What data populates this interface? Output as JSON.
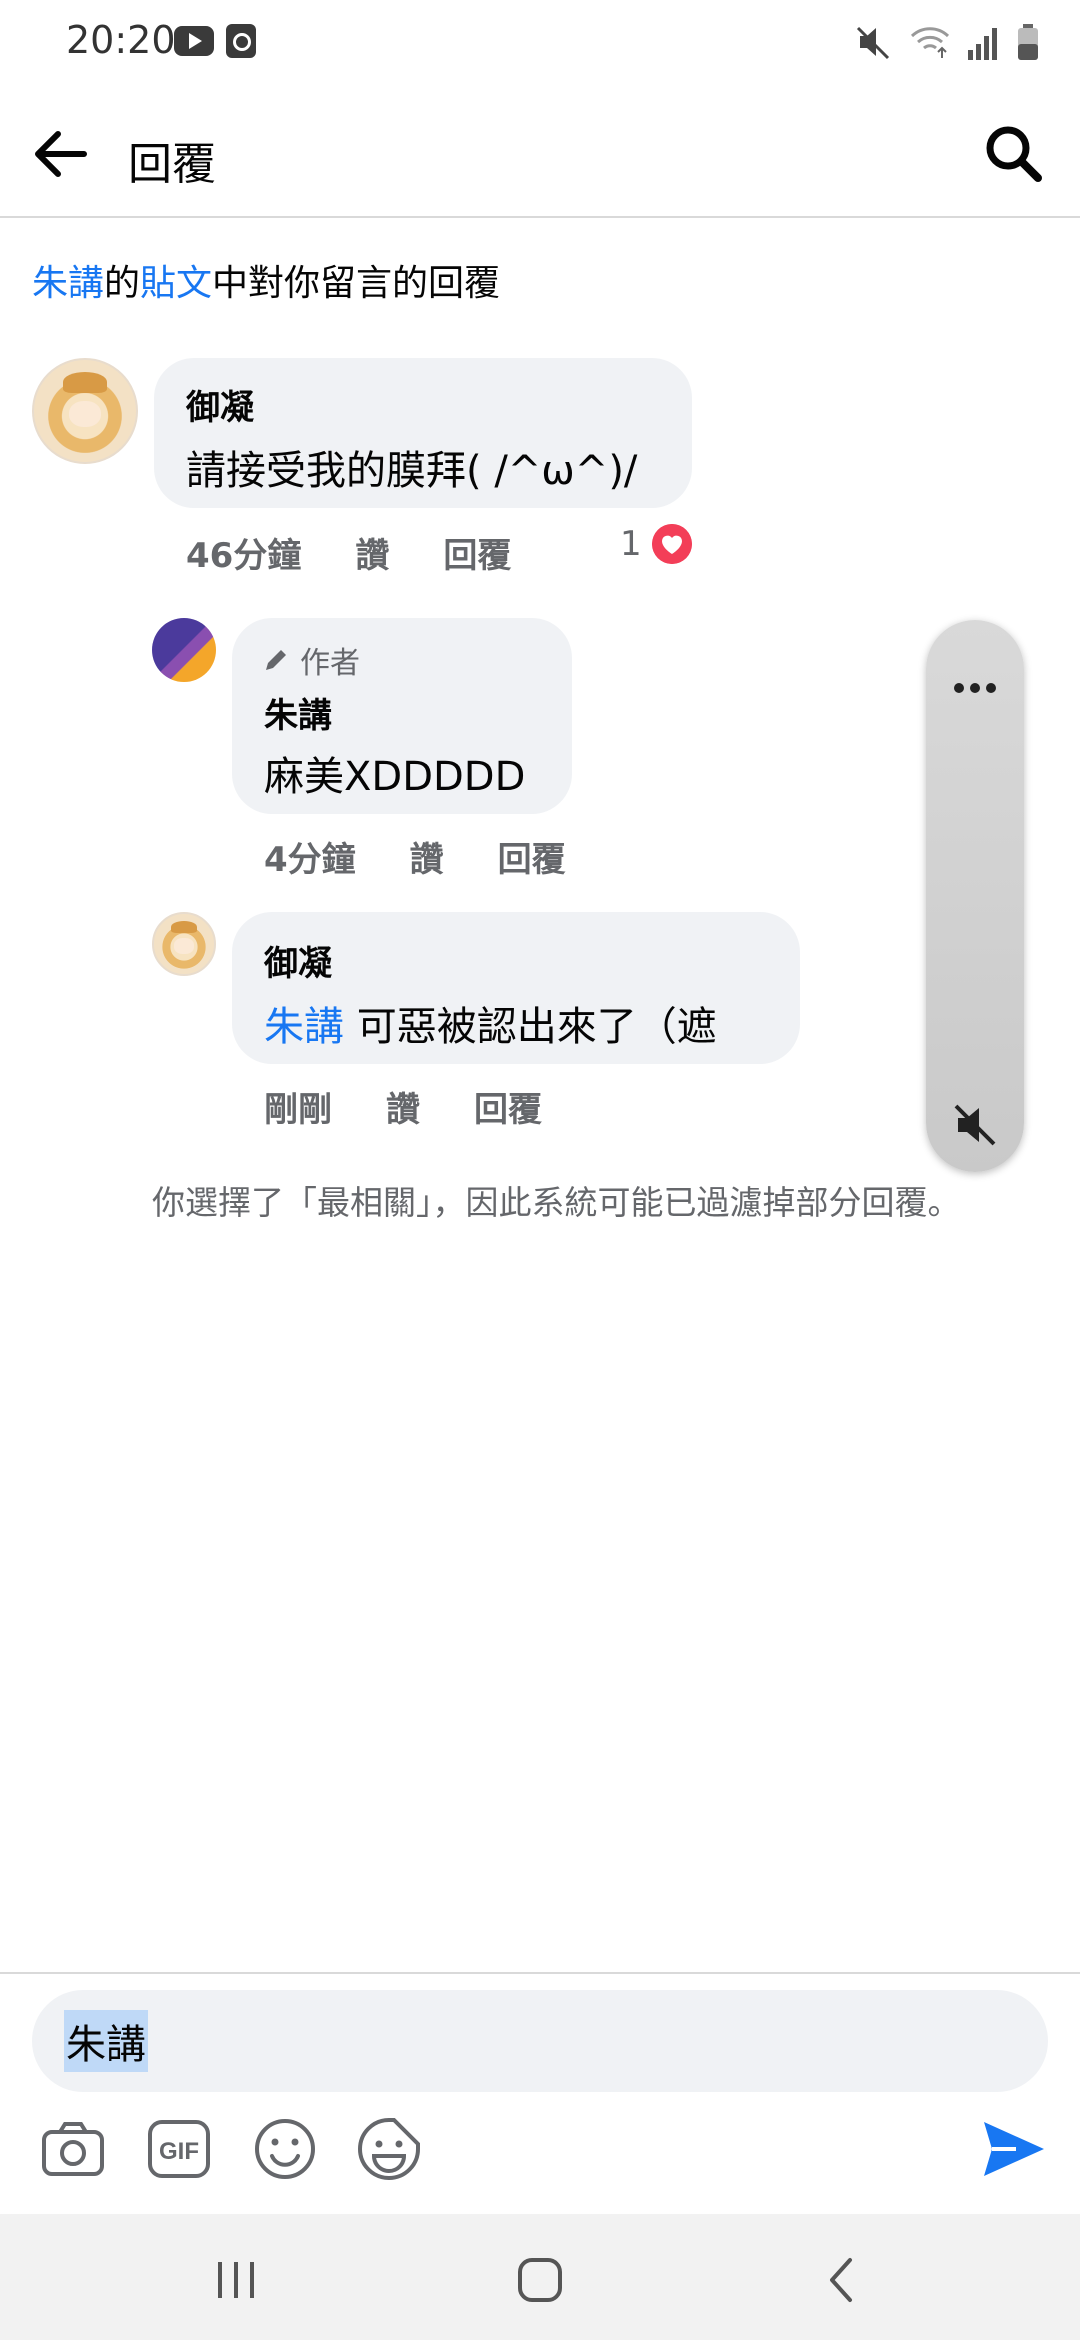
{
  "status_bar": {
    "time": "20:20",
    "icons": [
      "youtube-icon",
      "clock-app-icon",
      "mute-icon",
      "wifi-icon",
      "signal-icon",
      "battery-icon"
    ]
  },
  "header": {
    "title": "回覆",
    "back_icon": "arrow-left-icon",
    "search_icon": "search-icon"
  },
  "context": {
    "author_link": "朱講",
    "part1": "的",
    "post_link": "貼文",
    "part2": "中對你留言的回覆"
  },
  "comments": [
    {
      "name": "御凝",
      "text": "請接受我的膜拜( /^ω^)/",
      "time": "46分鐘",
      "like": "讚",
      "reply": "回覆",
      "reaction_count": "1",
      "reaction_icon": "heart-icon"
    },
    {
      "author_tag": "作者",
      "name": "朱講",
      "text": "麻美XDDDDD",
      "time": "4分鐘",
      "like": "讚",
      "reply": "回覆"
    },
    {
      "name": "御凝",
      "mention": "朱講",
      "text": "可惡被認出來了（遮",
      "time": "剛剛",
      "like": "讚",
      "reply": "回覆"
    }
  ],
  "filter_note": "你選擇了「最相關」，因此系統可能已過濾掉部分回覆。",
  "composer": {
    "text": "朱講",
    "tools": [
      "camera-icon",
      "gif-icon",
      "emoji-icon",
      "sticker-icon"
    ],
    "send_icon": "send-icon"
  },
  "colors": {
    "link": "#1877f2",
    "bubble": "#f0f2f5",
    "secondary_text": "#65676b",
    "heart": "#f33e58"
  }
}
